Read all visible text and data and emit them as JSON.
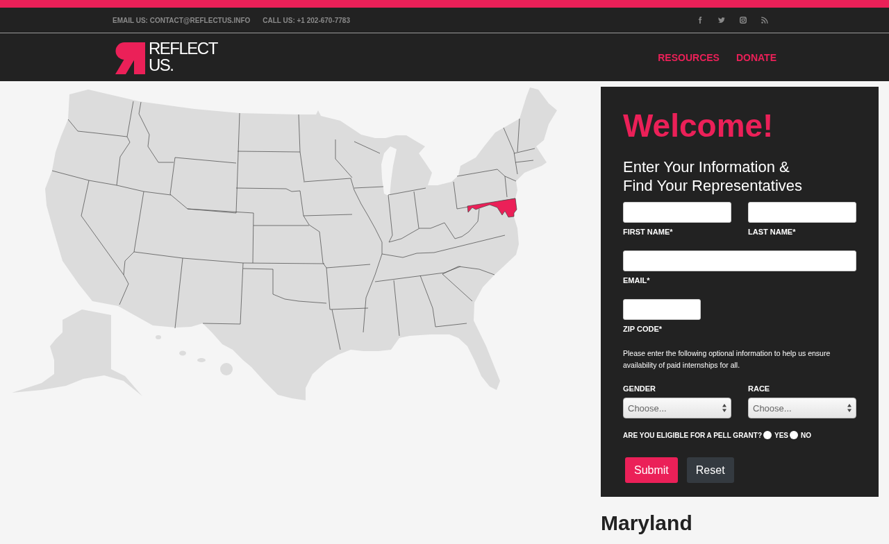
{
  "contact_bar": {
    "items": [
      "EMAIL US: CONTACT@REFLECTUS.INFO",
      "CALL US: +1 202-670-7783"
    ]
  },
  "logo": {
    "lines": [
      "REFLECT",
      "US."
    ]
  },
  "nav": {
    "links": [
      "RESOURCES",
      "DONATE"
    ]
  },
  "map": {
    "state_selected": true
  },
  "form": {
    "title": "Welcome!",
    "heading": "Enter Your Information & Find Your Representatives",
    "name_fields": [
      {
        "label": "FIRST NAME*"
      },
      {
        "label": "LAST NAME*"
      }
    ],
    "email_field": {
      "label": "EMAIL*"
    },
    "zip_field": {
      "label": "ZIP CODE*"
    },
    "note": "Please enter the following optional information to help us ensure availability of paid internships for all.",
    "selects": [
      {
        "label": "GENDER",
        "value": "Choose..."
      },
      {
        "label": "RACE",
        "value": "Choose..."
      }
    ],
    "pell_grant": {
      "question": "ARE YOU ELIGIBLE FOR A PELL GRANT?",
      "options": [
        {
          "label": "YES",
          "selected": false
        },
        {
          "label": "NO",
          "selected": false
        }
      ]
    },
    "buttons": [
      {
        "label": "Submit",
        "kind": "primary"
      },
      {
        "label": "Reset",
        "kind": "secondary"
      }
    ]
  },
  "state_heading": "Maryland"
}
